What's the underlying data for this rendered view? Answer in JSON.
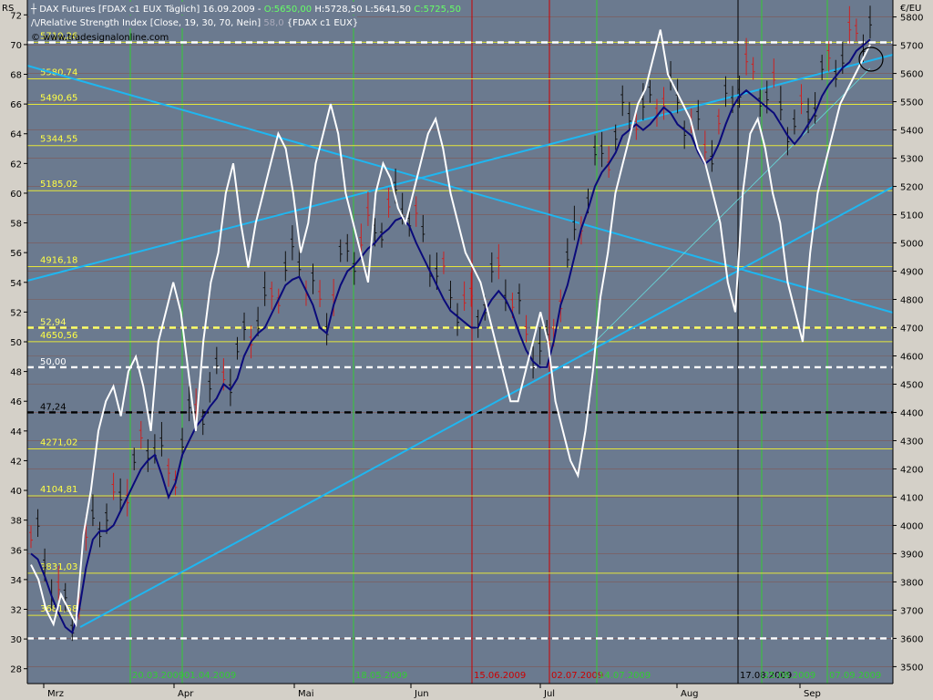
{
  "chart_data": {
    "type": "line",
    "instrument_line": "DAX Futures [FDAX c1 EUX  Täglich] 16.09.2009",
    "ohlc": {
      "open": "O:5650,00",
      "high": "H:5728,50",
      "low": "L:5641,50",
      "close": "C:5725,50"
    },
    "indicator_line": "Relative Strength Index [Close, 19, 30, 70, Nein]",
    "indicator_value": "58,0",
    "indicator_ref": "{FDAX c1 EUX}",
    "copyright": "© www.tradesignalonline.com",
    "left_axis": {
      "label": "RS",
      "range": [
        27,
        73
      ],
      "ticks": [
        28,
        30,
        32,
        34,
        36,
        38,
        40,
        42,
        44,
        46,
        48,
        50,
        52,
        54,
        56,
        58,
        60,
        62,
        64,
        66,
        68,
        70,
        72
      ]
    },
    "right_axis": {
      "label": "€/EU",
      "range": [
        3440,
        5860
      ],
      "ticks": [
        3500,
        3600,
        3700,
        3800,
        3900,
        4000,
        4100,
        4200,
        4300,
        4400,
        4500,
        4600,
        4700,
        4800,
        4900,
        5000,
        5100,
        5200,
        5300,
        5400,
        5500,
        5600,
        5700,
        5800
      ]
    },
    "months": [
      "Mrz",
      "Apr",
      "Mai",
      "Jun",
      "Jul",
      "Aug",
      "Sep"
    ],
    "horizontal_levels": [
      {
        "label": "5710,26",
        "value": 5710.26
      },
      {
        "label": "5580,74",
        "value": 5580.74
      },
      {
        "label": "5490,65",
        "value": 5490.65
      },
      {
        "label": "5344,55",
        "value": 5344.55
      },
      {
        "label": "5185,02",
        "value": 5185.02
      },
      {
        "label": "4916,18",
        "value": 4916.18
      },
      {
        "label": "4650,56",
        "value": 4650.56
      },
      {
        "label": "4271,02",
        "value": 4271.02
      },
      {
        "label": "4104,81",
        "value": 4104.81
      },
      {
        "label": "3831,03",
        "value": 3831.03
      },
      {
        "label": "3681,58",
        "value": 3681.58
      }
    ],
    "dashed_levels": [
      {
        "label": "",
        "value": 5710,
        "color": "#ffffff"
      },
      {
        "label": "52,94",
        "value": 4700,
        "color": "#ffff66"
      },
      {
        "label": "50,00",
        "value": 4560,
        "color": "#ffffff"
      },
      {
        "label": "47,24",
        "value": 4400,
        "color": "#000000"
      },
      {
        "label": "",
        "value": 3600,
        "color": "#ffffff"
      }
    ],
    "vertical_markers": [
      {
        "label": "20.03.2009",
        "color": "#33cc33"
      },
      {
        "label": "01.04.2009",
        "color": "#33cc33"
      },
      {
        "label": "18.05.2009",
        "color": "#33cc33"
      },
      {
        "label": "15.06.2009",
        "color": "#cc0000"
      },
      {
        "label": "02.07.2009",
        "color": "#cc0000"
      },
      {
        "label": "14.07.2009",
        "color": "#33cc33"
      },
      {
        "label": "17.08.2009",
        "color": "#000000"
      },
      {
        "label": "25.08.2009",
        "color": "#33cc33"
      },
      {
        "label": "07.09.2009",
        "color": "#33cc33"
      }
    ],
    "series": [
      {
        "values": [
          3900,
          3880,
          3820,
          3750,
          3690,
          3640,
          3620,
          3700,
          3850,
          3950,
          3980,
          3980,
          4000,
          4050,
          4100,
          4150,
          4200,
          4230,
          4250,
          4180,
          4100,
          4150,
          4250,
          4300,
          4350,
          4380,
          4420,
          4450,
          4500,
          4480,
          4520,
          4600,
          4650,
          4680,
          4700,
          4750,
          4800,
          4850,
          4870,
          4880,
          4830,
          4780,
          4700,
          4680,
          4780,
          4850,
          4900,
          4920,
          4950,
          4980,
          5000,
          5030,
          5050,
          5080,
          5090,
          5060,
          5000,
          4950,
          4900,
          4850,
          4800,
          4760,
          4740,
          4720,
          4700,
          4700,
          4760,
          4800,
          4830,
          4800,
          4750,
          4680,
          4620,
          4580,
          4560,
          4560,
          4650,
          4780,
          4850,
          4950,
          5050,
          5120,
          5200,
          5250,
          5280,
          5320,
          5380,
          5400,
          5420,
          5400,
          5420,
          5450,
          5480,
          5460,
          5420,
          5400,
          5380,
          5320,
          5280,
          5300,
          5350,
          5420,
          5480,
          5520,
          5540,
          5520,
          5500,
          5480,
          5460,
          5420,
          5380,
          5350,
          5380,
          5420,
          5460,
          5520,
          5560,
          5590,
          5620,
          5640,
          5680,
          5700,
          5720
        ]
      },
      {
        "values": [
          35,
          34,
          32,
          31,
          33,
          32,
          31,
          37,
          40,
          44,
          46,
          47,
          45,
          48,
          49,
          47,
          44,
          50,
          52,
          54,
          52,
          48,
          44,
          50,
          54,
          56,
          60,
          62,
          58,
          55,
          58,
          60,
          62,
          64,
          63,
          60,
          56,
          58,
          62,
          64,
          66,
          64,
          60,
          58,
          56,
          54,
          60,
          62,
          61,
          59,
          58,
          60,
          62,
          64,
          65,
          63,
          60,
          58,
          56,
          55,
          54,
          52,
          50,
          48,
          46,
          46,
          48,
          50,
          52,
          50,
          46,
          44,
          42,
          41,
          44,
          48,
          53,
          56,
          60,
          62,
          64,
          66,
          67,
          69,
          71,
          68,
          67,
          66,
          65,
          63,
          62,
          60,
          58,
          54,
          52,
          60,
          64,
          65,
          63,
          60,
          58,
          54,
          52,
          50,
          56,
          60,
          62,
          64,
          66,
          67,
          68,
          69,
          70
        ]
      }
    ]
  }
}
